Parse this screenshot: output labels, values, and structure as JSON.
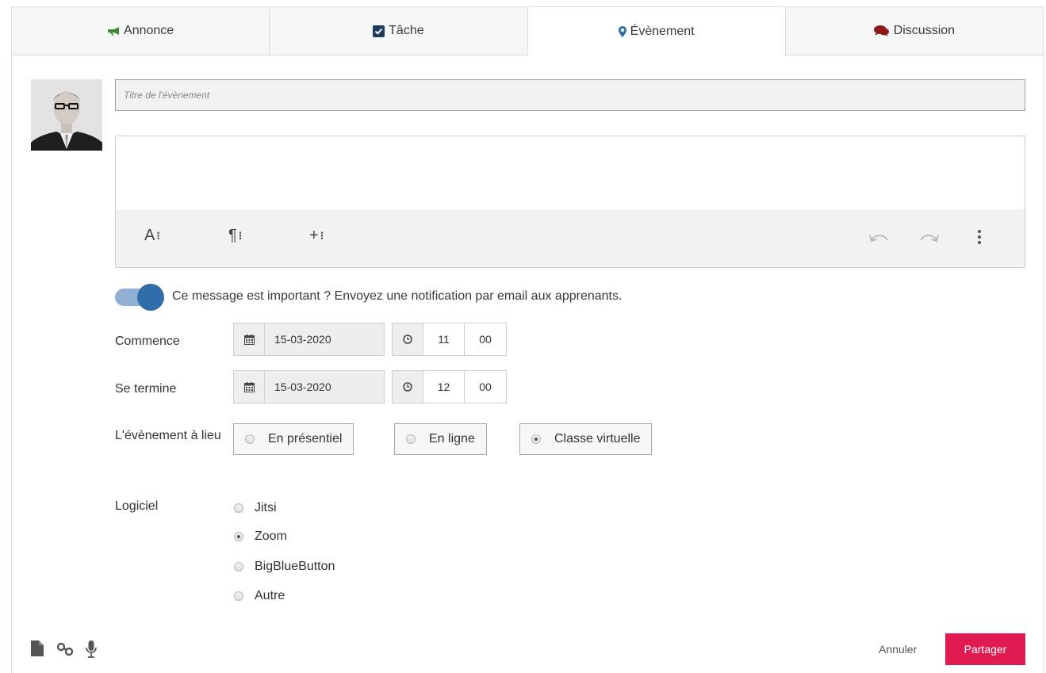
{
  "tabs": [
    {
      "label": "Annonce",
      "icon": "bullhorn-icon",
      "icon_color": "#3a8a3a",
      "active": false
    },
    {
      "label": "Tâche",
      "icon": "checkbox-icon",
      "icon_color": "#1f3a5c",
      "active": false
    },
    {
      "label": "Évènement",
      "icon": "map-marker-icon",
      "icon_color": "#2f6ea8",
      "active": true
    },
    {
      "label": "Discussion",
      "icon": "comments-icon",
      "icon_color": "#8b1a1a",
      "active": false
    }
  ],
  "title_input": {
    "placeholder": "Titre de l'évènement",
    "value": ""
  },
  "editor": {
    "toolbar": {
      "text_style": "A",
      "paragraph": "¶",
      "insert": "+",
      "undo_icon": "undo-icon",
      "redo_icon": "redo-icon",
      "more_icon": "more-vertical-icon"
    }
  },
  "notify": {
    "enabled": true,
    "text": "Ce message est important ? Envoyez une notification par email aux apprenants."
  },
  "start": {
    "label": "Commence",
    "date": "15-03-2020",
    "hour": "11",
    "minute": "00"
  },
  "end": {
    "label": "Se termine",
    "date": "15-03-2020",
    "hour": "12",
    "minute": "00"
  },
  "location": {
    "label": "L'évènement à lieu",
    "options": [
      {
        "label": "En présentiel",
        "checked": false
      },
      {
        "label": "En ligne",
        "checked": false
      },
      {
        "label": "Classe virtuelle",
        "checked": true
      }
    ]
  },
  "software": {
    "label": "Logiciel",
    "options": [
      {
        "label": "Jitsi",
        "checked": false
      },
      {
        "label": "Zoom",
        "checked": true
      },
      {
        "label": "BigBlueButton",
        "checked": false
      },
      {
        "label": "Autre",
        "checked": false
      }
    ]
  },
  "attachments": {
    "icons": [
      "file-icon",
      "link-icon",
      "microphone-icon"
    ]
  },
  "actions": {
    "cancel_label": "Annuler",
    "share_label": "Partager"
  },
  "colors": {
    "accent": "#2f6ea8",
    "share_button": "#e01b51"
  }
}
